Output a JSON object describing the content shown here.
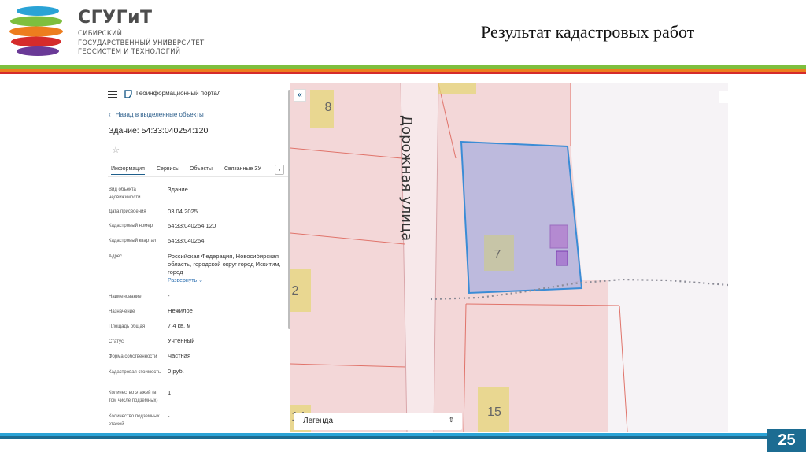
{
  "slide": {
    "logo": {
      "title": "СГУГиТ",
      "subtitle_lines": [
        "СИБИРСКИЙ",
        "ГОСУДАРСТВЕННЫЙ УНИВЕРСИТЕТ",
        "ГЕОСИСТЕМ И ТЕХНОЛОГИЙ"
      ]
    },
    "title": "Результат кадастровых работ",
    "page_number": "25",
    "colors": {
      "green": "#7ebf3e",
      "orange": "#ed7d1e",
      "red": "#d52b2b",
      "blue": "#1c6c92",
      "light_blue": "#2aa3d6"
    }
  },
  "portal": {
    "title": "Геоинформационный портал",
    "back_link": "Назад в выделенные объекты",
    "object_title": "Здание: 54:33:040254:120",
    "favorite_icon": "star-icon",
    "tabs": [
      {
        "label": "Информация",
        "active": true
      },
      {
        "label": "Сервисы",
        "active": false
      },
      {
        "label": "Объекты",
        "active": false
      },
      {
        "label": "Связанные ЗУ",
        "active": false
      }
    ],
    "attributes": [
      {
        "label": "Вид объекта недвижимости",
        "value": "Здание"
      },
      {
        "label": "Дата присвоения",
        "value": "03.04.2025"
      },
      {
        "label": "Кадастровый номер",
        "value": "54:33:040254:120"
      },
      {
        "label": "Кадастровый квартал",
        "value": "54:33:040254"
      },
      {
        "label": "Адрес",
        "value": "Российская Федерация, Новосибирская область, городской округ город Искитим, город"
      },
      {
        "label": "Наименование",
        "value": "-"
      },
      {
        "label": "Назначение",
        "value": "Нежилое"
      },
      {
        "label": "Площадь общая",
        "value": "7,4 кв. м"
      },
      {
        "label": "Статус",
        "value": "Учтенный"
      },
      {
        "label": "Форма собственности",
        "value": "Частная"
      },
      {
        "label": "Кадастровая стоимость",
        "value": "0 руб."
      },
      {
        "label": "Количество этажей (в том числе подземных)",
        "value": "1"
      },
      {
        "label": "Количество подземных этажей",
        "value": "-"
      }
    ],
    "expand_label": "Развернуть"
  },
  "map": {
    "street_label": "Дорожная улица",
    "parcel_numbers": [
      "8",
      "7",
      "2",
      "15",
      "14"
    ],
    "legend_label": "Легенда",
    "colors": {
      "background": "#f3d7d8",
      "boundary": "#e0736a",
      "road": "#f7e8ea",
      "selected_parcel": "#b7b7de",
      "selected_border": "#3a8cd6",
      "number_box": "#e6d77a",
      "building": "#b48ad1",
      "right_area": "#f6f3f6"
    }
  }
}
